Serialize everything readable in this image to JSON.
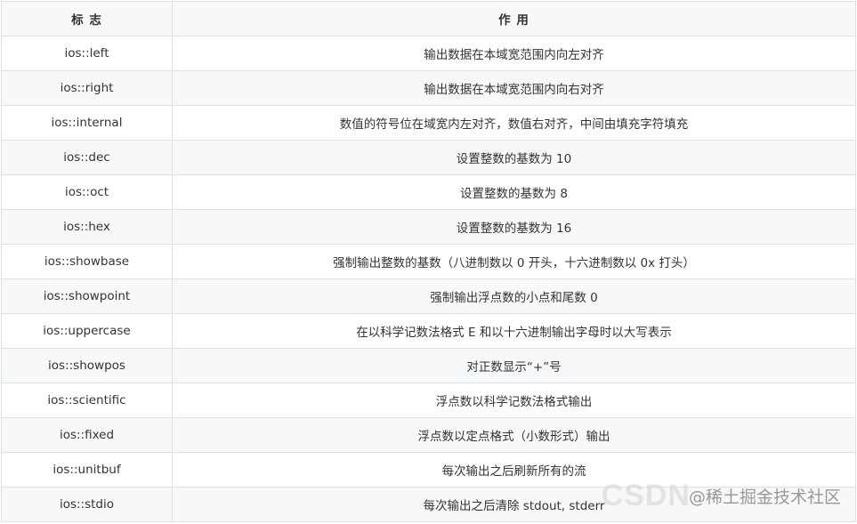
{
  "table": {
    "headers": [
      "标 志",
      "作 用"
    ],
    "rows": [
      [
        "ios::left",
        "输出数据在本域宽范围内向左对齐"
      ],
      [
        "ios::right",
        "输出数据在本域宽范围内向右对齐"
      ],
      [
        "ios::internal",
        "数值的符号位在域宽内左对齐，数值右对齐，中间由填充字符填充"
      ],
      [
        "ios::dec",
        "设置整数的基数为 10"
      ],
      [
        "ios::oct",
        "设置整数的基数为 8"
      ],
      [
        "ios::hex",
        "设置整数的基数为 16"
      ],
      [
        "ios::showbase",
        "强制输出整数的基数（八进制数以 0 开头，十六进制数以 0x 打头）"
      ],
      [
        "ios::showpoint",
        "强制输出浮点数的小点和尾数 0"
      ],
      [
        "ios::uppercase",
        "在以科学记数法格式 E 和以十六进制输出字母时以大写表示"
      ],
      [
        "ios::showpos",
        "对正数显示“+”号"
      ],
      [
        "ios::scientific",
        "浮点数以科学记数法格式输出"
      ],
      [
        "ios::fixed",
        "浮点数以定点格式（小数形式）输出"
      ],
      [
        "ios::unitbuf",
        "每次输出之后刷新所有的流"
      ],
      [
        "ios::stdio",
        "每次输出之后清除 stdout, stderr"
      ]
    ]
  },
  "watermark": {
    "csdn": "CSDN",
    "brand": "@稀土掘金技术社区"
  }
}
